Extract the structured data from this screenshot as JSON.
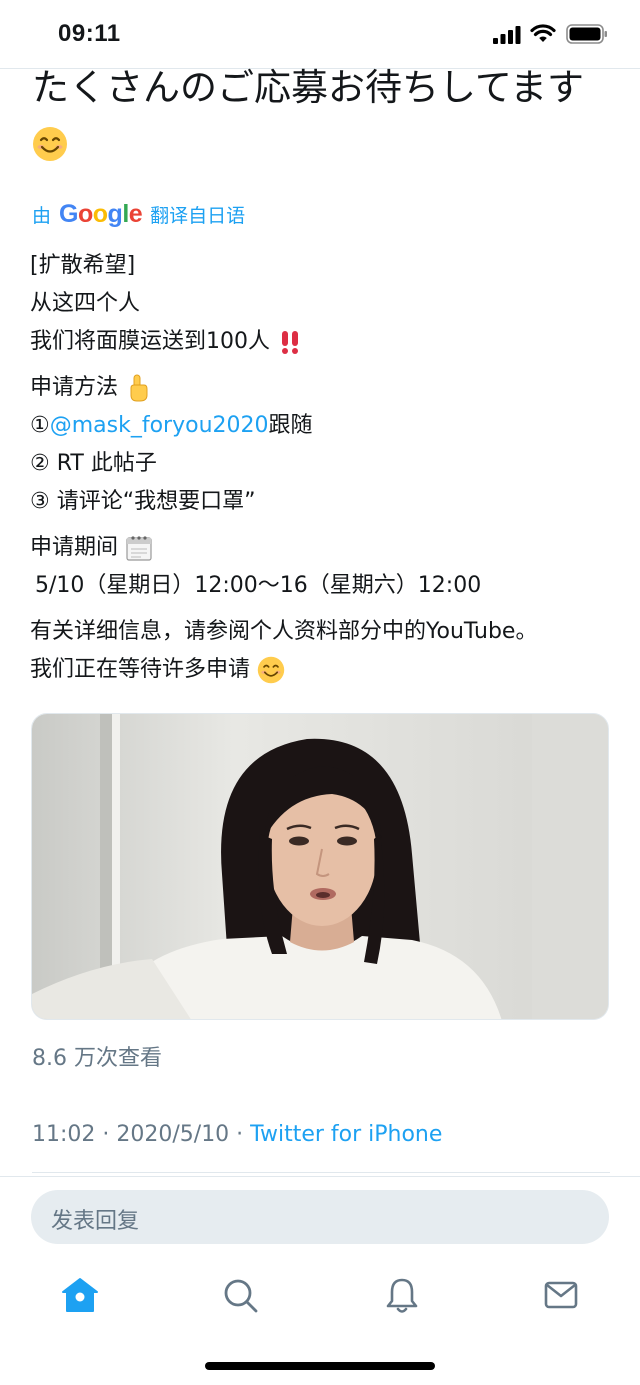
{
  "status_bar": {
    "time": "09:11"
  },
  "tweet": {
    "original_text": "たくさんのご応募お待ちしてます",
    "translated_by": {
      "prefix": "由",
      "provider": "Google",
      "suffix": "翻译自日语"
    },
    "translated_lines": {
      "line1": "[扩散希望]",
      "line2": "从这四个人",
      "line3": "我们将面膜运送到100人",
      "line4": "申请方法",
      "line5_prefix": "①",
      "line5_mention": "@mask_foryou2020",
      "line5_suffix": "跟随",
      "line6": "② RT 此帖子",
      "line7": "③ 请评论“我想要口罩”",
      "line8": "申请期间",
      "line9": "5/10（星期日）12:00～16（星期六）12:00",
      "line10": "有关详细信息，请参阅个人资料部分中的YouTube。",
      "line11": "我们正在等待许多申请"
    },
    "views": "8.6 万次查看",
    "timestamp": "11:02 · 2020/5/10 · ",
    "source": "Twitter for iPhone"
  },
  "reply": {
    "placeholder": "发表回复"
  },
  "tab_bar": {
    "items": [
      "home-icon",
      "search-icon",
      "notifications-icon",
      "messages-icon"
    ]
  },
  "colors": {
    "accent": "#1da1f2",
    "muted": "#657786",
    "text": "#14171a",
    "reply_bg": "#e6ecf0"
  }
}
